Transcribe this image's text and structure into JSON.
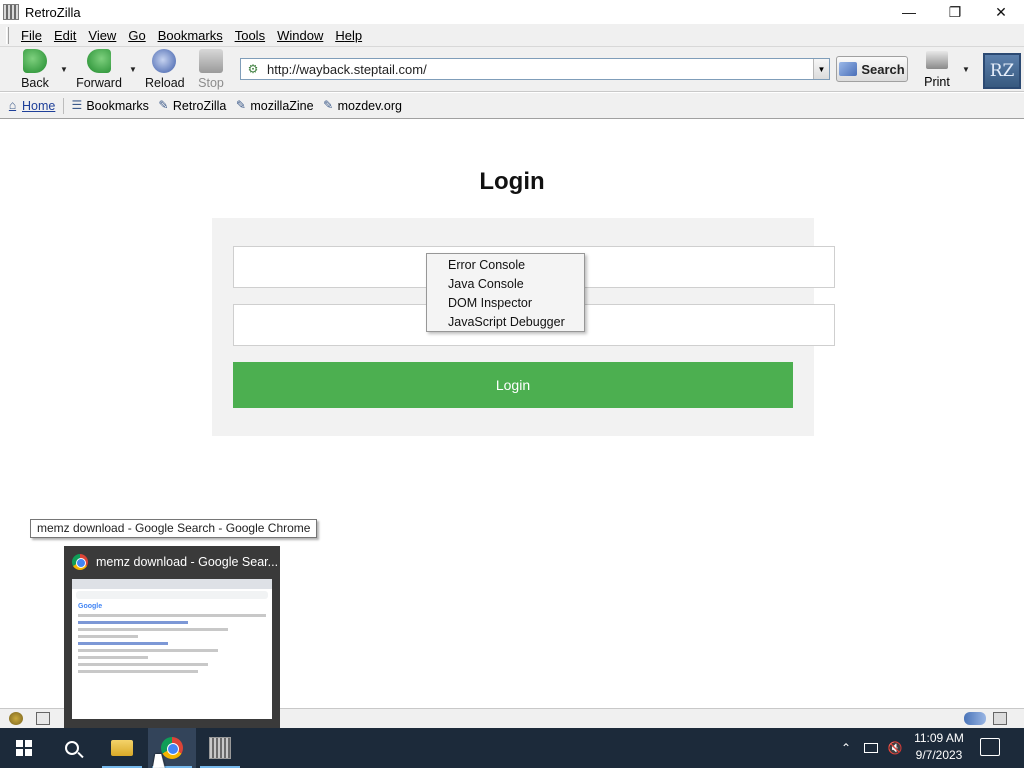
{
  "window": {
    "title": "RetroZilla",
    "controls": [
      "minimize",
      "restore",
      "close"
    ]
  },
  "menubar": {
    "items": [
      "File",
      "Edit",
      "View",
      "Go",
      "Bookmarks",
      "Tools",
      "Window",
      "Help"
    ]
  },
  "navbar": {
    "back_label": "Back",
    "forward_label": "Forward",
    "reload_label": "Reload",
    "stop_label": "Stop",
    "url": "http://wayback.steptail.com/",
    "search_label": "Search",
    "print_label": "Print",
    "logo_text": "RZ"
  },
  "bookmarks_bar": {
    "items": [
      "Home",
      "Bookmarks",
      "RetroZilla",
      "mozillaZine",
      "mozdev.org"
    ]
  },
  "page": {
    "heading": "Login",
    "username_value": "",
    "password_value": "",
    "login_button": "Login"
  },
  "tools_submenu": {
    "items": [
      "Error Console",
      "Java Console",
      "DOM Inspector",
      "JavaScript Debugger"
    ]
  },
  "taskbar_preview": {
    "tooltip": "memz download - Google Search - Google Chrome",
    "title": "memz download - Google Sear..."
  },
  "system_tray": {
    "time": "11:09 AM",
    "date": "9/7/2023"
  }
}
